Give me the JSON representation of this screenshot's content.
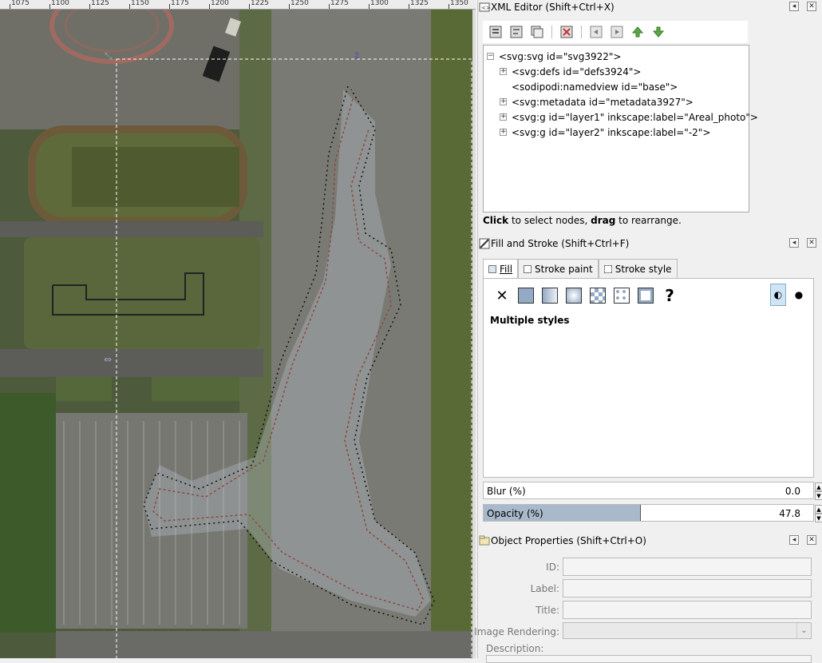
{
  "ruler": {
    "labels": [
      "1075",
      "1100",
      "1125",
      "1150",
      "1175",
      "1200",
      "1225",
      "1250",
      "1275",
      "1300",
      "1325",
      "1350"
    ]
  },
  "xml_editor": {
    "title": "XML Editor (Shift+Ctrl+X)",
    "toolbar_buttons": [
      "new-element-node-icon",
      "new-text-node-icon",
      "duplicate-node-icon",
      "delete-node-icon",
      "unindent-node-icon",
      "indent-node-icon",
      "raise-node-icon",
      "lower-node-icon"
    ],
    "nodes": [
      {
        "text": "<svg:svg id=\"svg3922\">",
        "expander": "−"
      },
      {
        "text": "<svg:defs id=\"defs3924\">",
        "expander": "+"
      },
      {
        "text": "<sodipodi:namedview id=\"base\">",
        "expander": ""
      },
      {
        "text": "<svg:metadata id=\"metadata3927\">",
        "expander": "+"
      },
      {
        "text": "<svg:g id=\"layer1\" inkscape:label=\"Areal_photo\">",
        "expander": "+"
      },
      {
        "text": "<svg:g id=\"layer2\" inkscape:label=\"-2\">",
        "expander": "+"
      }
    ],
    "hint_click": "Click",
    "hint_mid": " to select nodes, ",
    "hint_drag": "drag",
    "hint_end": " to rearrange."
  },
  "fill_stroke": {
    "title": "Fill and Stroke (Shift+Ctrl+F)",
    "tabs": [
      "Fill",
      "Stroke paint",
      "Stroke style"
    ],
    "paint_buttons": [
      "no-paint-icon",
      "flat-color-icon",
      "linear-gradient-icon",
      "radial-gradient-icon",
      "pattern-icon",
      "swatch-icon",
      "unset-paint-icon"
    ],
    "fill_rule_buttons": [
      "fill-rule-evenodd-icon",
      "fill-rule-nonzero-icon"
    ],
    "status": "Multiple styles",
    "blur_label": "Blur (%)",
    "blur_value": "0.0",
    "opacity_label": "Opacity (%)",
    "opacity_value": "47.8",
    "opacity_fraction": 0.478
  },
  "object_properties": {
    "title": "Object Properties (Shift+Ctrl+O)",
    "id_label": "ID:",
    "label_label": "Label:",
    "title_label": "Title:",
    "rendering_label": "Image Rendering:",
    "description_label": "Description:"
  },
  "colors": {
    "accent": "#cfe5f7",
    "opacity_bar": "#a7b9ca"
  }
}
